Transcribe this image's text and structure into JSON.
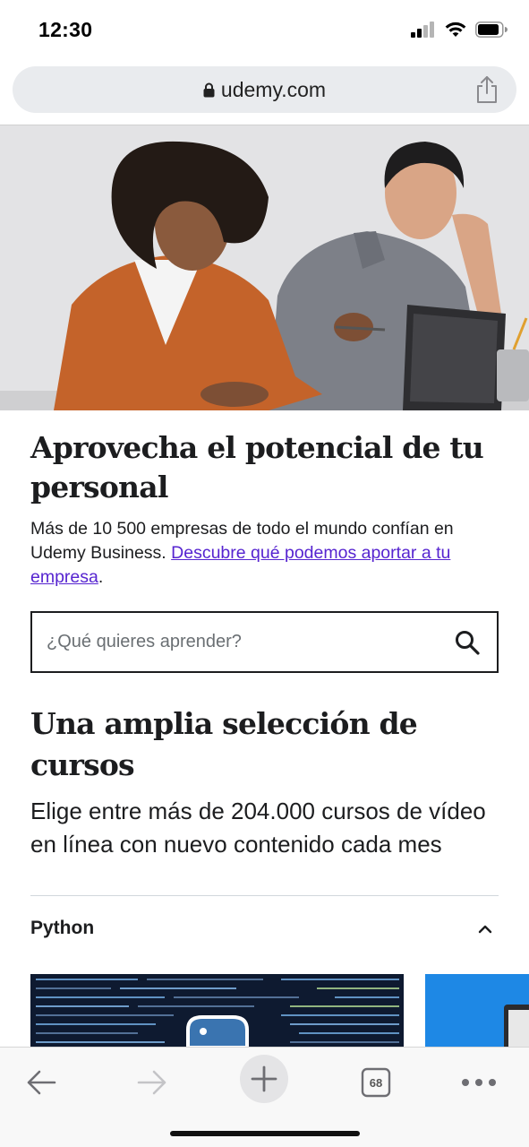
{
  "status_bar": {
    "time": "12:30"
  },
  "browser": {
    "url": "udemy.com",
    "tab_count": "68"
  },
  "hero": {
    "title": "Aprovecha el potencial de tu personal",
    "description_prefix": "Más de 10 500 empresas de todo el mundo confían en Udemy Business. ",
    "link_text": "Descubre qué podemos aportar a tu empresa",
    "description_suffix": "."
  },
  "search": {
    "placeholder": "¿Qué quieres aprender?",
    "value": ""
  },
  "courses_section": {
    "title": "Una amplia selección de cursos",
    "subtitle": "Elige entre más de 204.000 cursos de vídeo en línea con nuevo contenido cada mes",
    "accordion": {
      "label": "Python",
      "expanded": true
    }
  },
  "icons": {
    "lock": "lock-icon",
    "share": "share-icon",
    "search": "search-icon",
    "chevron": "chevron-up-icon",
    "back": "back-arrow-icon",
    "forward": "forward-arrow-icon",
    "new_tab": "plus-icon",
    "tabs": "tabs-icon",
    "menu": "more-icon"
  },
  "colors": {
    "link": "#5624d0",
    "text": "#1c1d1f",
    "border": "#1c1d1f"
  }
}
